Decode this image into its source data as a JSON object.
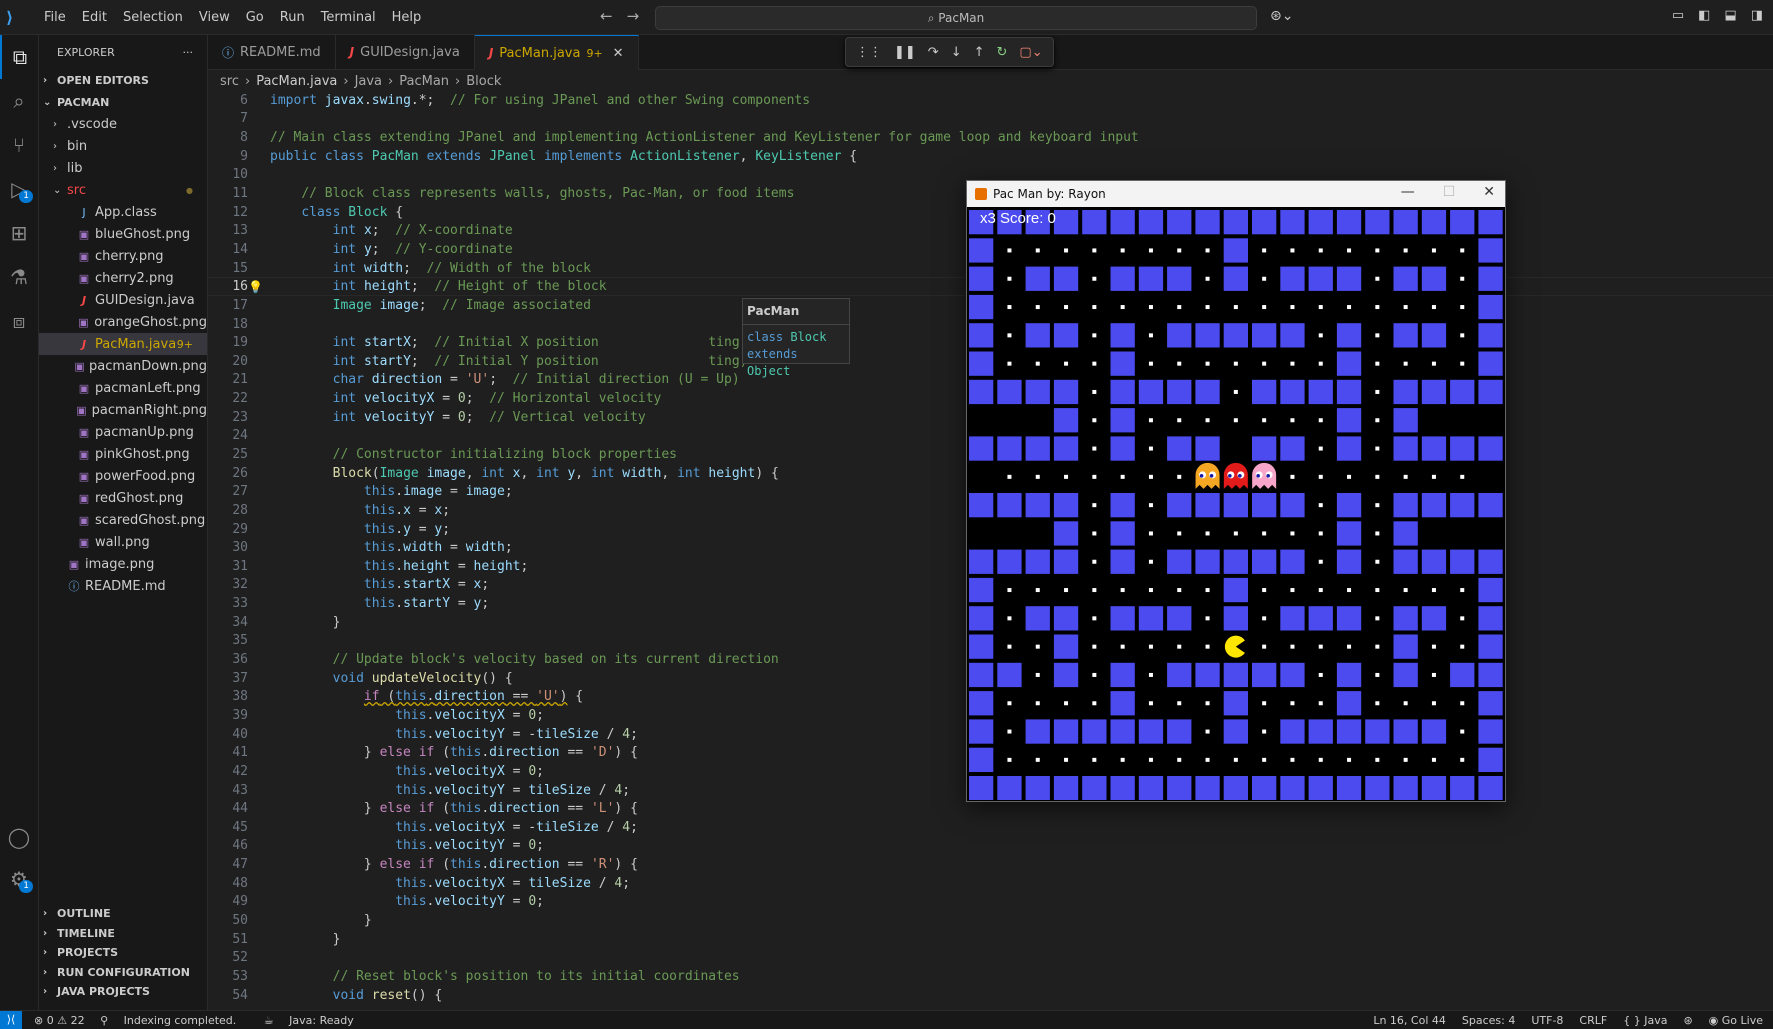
{
  "menubar": {
    "items": [
      "File",
      "Edit",
      "Selection",
      "View",
      "Go",
      "Run",
      "Terminal",
      "Help"
    ]
  },
  "command_center": {
    "text": "PacMan"
  },
  "activity_bar": {
    "icons": [
      "explorer-icon",
      "search-icon",
      "source-control-icon",
      "run-debug-icon",
      "extensions-icon",
      "testing-icon",
      "remote-explorer-icon"
    ],
    "debug_badge": "1",
    "account_badge": "1"
  },
  "sidebar": {
    "title": "EXPLORER",
    "open_editors": "OPEN EDITORS",
    "root": "PACMAN",
    "items": [
      {
        "label": ".vscode",
        "type": "folder",
        "indent": 1
      },
      {
        "label": "bin",
        "type": "folder",
        "indent": 1
      },
      {
        "label": "lib",
        "type": "folder",
        "indent": 1
      },
      {
        "label": "src",
        "type": "folder-open",
        "indent": 1,
        "color": "#f44747"
      },
      {
        "label": "App.class",
        "type": "class",
        "indent": 2
      },
      {
        "label": "blueGhost.png",
        "type": "png",
        "indent": 2
      },
      {
        "label": "cherry.png",
        "type": "png",
        "indent": 2
      },
      {
        "label": "cherry2.png",
        "type": "png",
        "indent": 2
      },
      {
        "label": "GUIDesign.java",
        "type": "java",
        "indent": 2
      },
      {
        "label": "orangeGhost.png",
        "type": "png",
        "indent": 2
      },
      {
        "label": "PacMan.java",
        "type": "java",
        "indent": 2,
        "selected": true,
        "badge": "9+"
      },
      {
        "label": "pacmanDown.png",
        "type": "png",
        "indent": 2
      },
      {
        "label": "pacmanLeft.png",
        "type": "png",
        "indent": 2
      },
      {
        "label": "pacmanRight.png",
        "type": "png",
        "indent": 2
      },
      {
        "label": "pacmanUp.png",
        "type": "png",
        "indent": 2
      },
      {
        "label": "pinkGhost.png",
        "type": "png",
        "indent": 2
      },
      {
        "label": "powerFood.png",
        "type": "png",
        "indent": 2
      },
      {
        "label": "redGhost.png",
        "type": "png",
        "indent": 2
      },
      {
        "label": "scaredGhost.png",
        "type": "png",
        "indent": 2
      },
      {
        "label": "wall.png",
        "type": "png",
        "indent": 2
      },
      {
        "label": "image.png",
        "type": "png",
        "indent": 1
      },
      {
        "label": "README.md",
        "type": "info",
        "indent": 1
      }
    ],
    "bottom_sections": [
      "OUTLINE",
      "TIMELINE",
      "PROJECTS",
      "RUN CONFIGURATION",
      "JAVA PROJECTS"
    ]
  },
  "tabs": [
    {
      "label": "README.md",
      "icon": "info"
    },
    {
      "label": "GUIDesign.java",
      "icon": "java"
    },
    {
      "label": "PacMan.java",
      "icon": "java",
      "active": true,
      "badge": "9+"
    }
  ],
  "breadcrumb": [
    "src",
    "PacMan.java",
    "Java",
    "PacMan",
    "Block"
  ],
  "hover": {
    "title": "PacMan",
    "line1_kw": "class",
    "line1_name": "Block",
    "line2_kw": "extends",
    "line2_name": "Object"
  },
  "code_lines": [
    {
      "n": "6",
      "html": "<span class='k'>import</span> <span class='vr'>javax</span>.<span class='vr'>swing</span>.*;  <span class='cm'>// For using JPanel and other Swing components</span>"
    },
    {
      "n": "7",
      "html": ""
    },
    {
      "n": "8",
      "html": "<span class='cm'>// Main class extending JPanel and implementing ActionListener and KeyListener for game loop and keyboard input</span>"
    },
    {
      "n": "9",
      "html": "<span class='k'>public</span> <span class='k'>class</span> <span class='ty'>PacMan</span> <span class='k'>extends</span> <span class='ty'>JPanel</span> <span class='k'>implements</span> <span class='ty'>ActionListener</span>, <span class='ty'>KeyListener</span> {"
    },
    {
      "n": "10",
      "html": ""
    },
    {
      "n": "11",
      "html": "    <span class='cm'>// Block class represents walls, ghosts, Pac-Man, or food items</span>"
    },
    {
      "n": "12",
      "html": "    <span class='k'>class</span> <span class='ty'>Block</span> {"
    },
    {
      "n": "13",
      "html": "        <span class='k'>int</span> <span class='vr'>x</span>;  <span class='cm'>// X-coordinate</span>"
    },
    {
      "n": "14",
      "html": "        <span class='k'>int</span> <span class='vr'>y</span>;  <span class='cm'>// Y-coordinate</span>"
    },
    {
      "n": "15",
      "html": "        <span class='k'>int</span> <span class='vr'>width</span>;  <span class='cm'>// Width of the block</span>"
    },
    {
      "n": "16",
      "html": "        <span class='k'>int</span> <span class='vr'>height</span>;  <span class='cm'>// Height of the block</span>",
      "current": true
    },
    {
      "n": "17",
      "html": "        <span class='ty'>Image</span> <span class='vr'>image</span>;  <span class='cm'>// Image associated</span>"
    },
    {
      "n": "18",
      "html": ""
    },
    {
      "n": "19",
      "html": "        <span class='k'>int</span> <span class='vr'>startX</span>;  <span class='cm'>// Initial X position</span>              <span class='cm'>ting)</span>"
    },
    {
      "n": "20",
      "html": "        <span class='k'>int</span> <span class='vr'>startY</span>;  <span class='cm'>// Initial Y position</span>              <span class='cm'>ting)</span>"
    },
    {
      "n": "21",
      "html": "        <span class='k'>char</span> <span class='vr'>direction</span> = <span class='st'>'U'</span>;  <span class='cm'>// Initial direction (U = Up)</span>"
    },
    {
      "n": "22",
      "html": "        <span class='k'>int</span> <span class='vr'>velocityX</span> = <span class='nm'>0</span>;  <span class='cm'>// Horizontal velocity</span>"
    },
    {
      "n": "23",
      "html": "        <span class='k'>int</span> <span class='vr'>velocityY</span> = <span class='nm'>0</span>;  <span class='cm'>// Vertical velocity</span>"
    },
    {
      "n": "24",
      "html": ""
    },
    {
      "n": "25",
      "html": "        <span class='cm'>// Constructor initializing block properties</span>"
    },
    {
      "n": "26",
      "html": "        <span class='fn'>Block</span>(<span class='ty'>Image</span> <span class='vr'>image</span>, <span class='k'>int</span> <span class='vr'>x</span>, <span class='k'>int</span> <span class='vr'>y</span>, <span class='k'>int</span> <span class='vr'>width</span>, <span class='k'>int</span> <span class='vr'>height</span>) {"
    },
    {
      "n": "27",
      "html": "            <span class='k'>this</span>.<span class='vr'>image</span> = <span class='vr'>image</span>;"
    },
    {
      "n": "28",
      "html": "            <span class='k'>this</span>.<span class='vr'>x</span> = <span class='vr'>x</span>;"
    },
    {
      "n": "29",
      "html": "            <span class='k'>this</span>.<span class='vr'>y</span> = <span class='vr'>y</span>;"
    },
    {
      "n": "30",
      "html": "            <span class='k'>this</span>.<span class='vr'>width</span> = <span class='vr'>width</span>;"
    },
    {
      "n": "31",
      "html": "            <span class='k'>this</span>.<span class='vr'>height</span> = <span class='vr'>height</span>;"
    },
    {
      "n": "32",
      "html": "            <span class='k'>this</span>.<span class='vr'>startX</span> = <span class='vr'>x</span>;"
    },
    {
      "n": "33",
      "html": "            <span class='k'>this</span>.<span class='vr'>startY</span> = <span class='vr'>y</span>;"
    },
    {
      "n": "34",
      "html": "        }"
    },
    {
      "n": "35",
      "html": ""
    },
    {
      "n": "36",
      "html": "        <span class='cm'>// Update block's velocity based on its current direction</span>"
    },
    {
      "n": "37",
      "html": "        <span class='k'>void</span> <span class='fn'>updateVelocity</span>() {"
    },
    {
      "n": "38",
      "html": "            <span class='kc' style='text-decoration:underline wavy #cca700;'>if</span><span style='text-decoration:underline wavy #cca700;'> (<span class='k'>this</span>.<span class='vr'>direction</span> == <span class='st'>'U'</span>)</span> {"
    },
    {
      "n": "39",
      "html": "                <span class='k'>this</span>.<span class='vr'>velocityX</span> = <span class='nm'>0</span>;"
    },
    {
      "n": "40",
      "html": "                <span class='k'>this</span>.<span class='vr'>velocityY</span> = -<span class='vr'>tileSize</span> / <span class='nm'>4</span>;"
    },
    {
      "n": "41",
      "html": "            } <span class='kc'>else</span> <span class='kc'>if</span> (<span class='k'>this</span>.<span class='vr'>direction</span> == <span class='st'>'D'</span>) {"
    },
    {
      "n": "42",
      "html": "                <span class='k'>this</span>.<span class='vr'>velocityX</span> = <span class='nm'>0</span>;"
    },
    {
      "n": "43",
      "html": "                <span class='k'>this</span>.<span class='vr'>velocityY</span> = <span class='vr'>tileSize</span> / <span class='nm'>4</span>;"
    },
    {
      "n": "44",
      "html": "            } <span class='kc'>else</span> <span class='kc'>if</span> (<span class='k'>this</span>.<span class='vr'>direction</span> == <span class='st'>'L'</span>) {"
    },
    {
      "n": "45",
      "html": "                <span class='k'>this</span>.<span class='vr'>velocityX</span> = -<span class='vr'>tileSize</span> / <span class='nm'>4</span>;"
    },
    {
      "n": "46",
      "html": "                <span class='k'>this</span>.<span class='vr'>velocityY</span> = <span class='nm'>0</span>;"
    },
    {
      "n": "47",
      "html": "            } <span class='kc'>else</span> <span class='kc'>if</span> (<span class='k'>this</span>.<span class='vr'>direction</span> == <span class='st'>'R'</span>) {"
    },
    {
      "n": "48",
      "html": "                <span class='k'>this</span>.<span class='vr'>velocityX</span> = <span class='vr'>tileSize</span> / <span class='nm'>4</span>;"
    },
    {
      "n": "49",
      "html": "                <span class='k'>this</span>.<span class='vr'>velocityY</span> = <span class='nm'>0</span>;"
    },
    {
      "n": "50",
      "html": "            }"
    },
    {
      "n": "51",
      "html": "        }"
    },
    {
      "n": "52",
      "html": ""
    },
    {
      "n": "53",
      "html": "        <span class='cm'>// Reset block's position to its initial coordinates</span>"
    },
    {
      "n": "54",
      "html": "        <span class='k'>void</span> <span class='fn'>reset</span>() {"
    }
  ],
  "statusbar": {
    "problems": "⊗ 0 ⚠ 22",
    "indexing": "Indexing completed.",
    "java": "Java: Ready",
    "position": "Ln 16, Col 44",
    "spaces": "Spaces: 4",
    "encoding": "UTF-8",
    "eol": "CRLF",
    "language": "Java",
    "golive": "Go Live"
  },
  "game": {
    "window_title": "Pac Man by: Rayon",
    "lives": "x3",
    "score_text": "Score: 0",
    "wall_color": "#4b4bef",
    "map": [
      "XXXXXXXXXXXXXXXXXXX",
      "X........X........X",
      "X.XX.XXX.X.XXX.XX.X",
      "X.................X",
      "X.XX.X.XXXXX.X.XX.X",
      "X....X.......X....X",
      "XXXX.XXXX.XXXX.XXXX",
      "OOOX.X.......X.XOOO",
      "XXXX.X.XXrXX.X.XXXX",
      "O.......bpo.......O",
      "XXXX.X.XXXXX.X.XXXX",
      "OOOX.X.......X.XOOO",
      "XXXX.X.XXXXX.X.XXXX",
      "X........X........X",
      "X.XX.XXX.X.XXX.XX.X",
      "X..X.....P.....X..X",
      "XX.X.X.XXXXX.X.X.XX",
      "X....X...X...X....X",
      "X.XXXXXX.X.XXXXXX.X",
      "X.................X",
      "XXXXXXXXXXXXXXXXXXX"
    ]
  }
}
